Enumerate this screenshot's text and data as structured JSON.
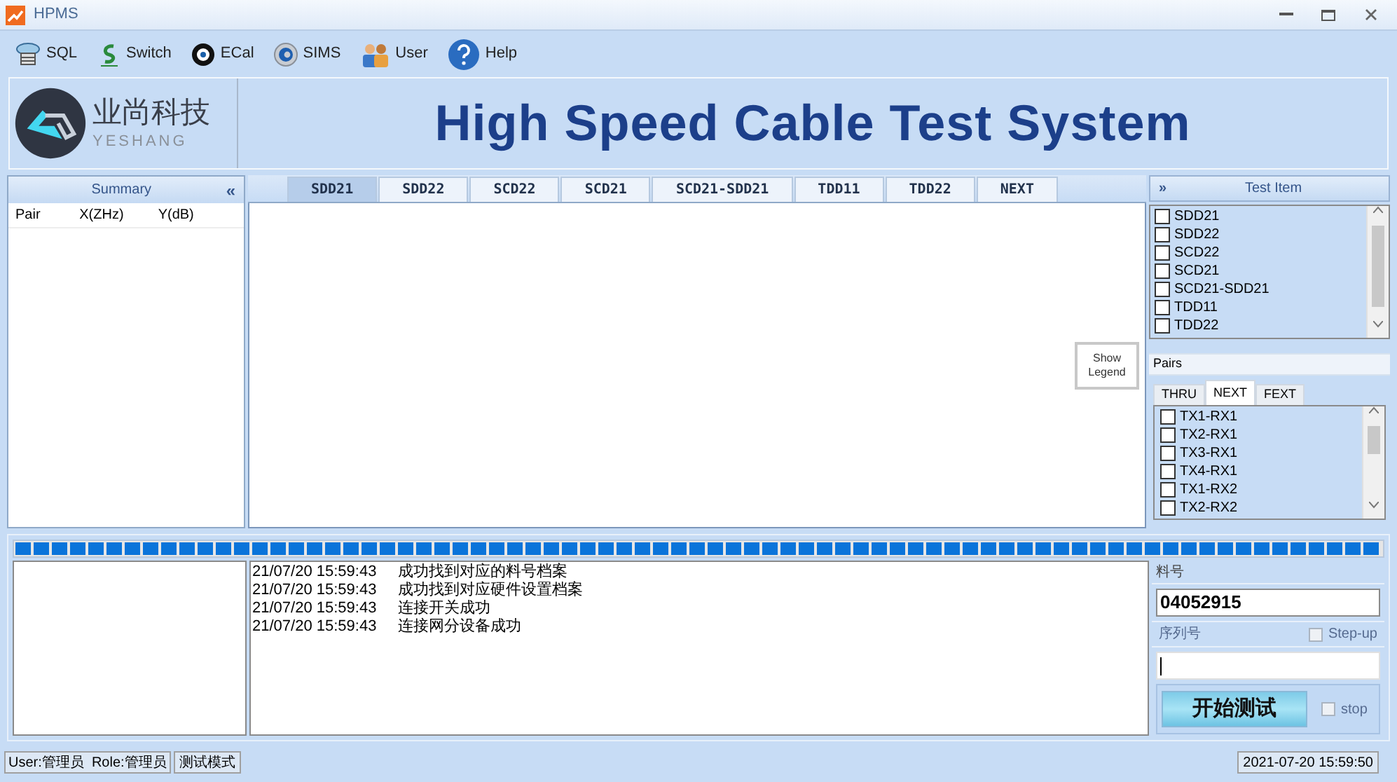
{
  "window": {
    "title": "HPMS"
  },
  "toolbar": [
    {
      "label": "SQL",
      "kind": "sql"
    },
    {
      "label": "Switch",
      "kind": "switch"
    },
    {
      "label": "ECal",
      "kind": "ecal"
    },
    {
      "label": "SIMS",
      "kind": "sims"
    },
    {
      "label": "User",
      "kind": "user"
    },
    {
      "label": "Help",
      "kind": "help"
    }
  ],
  "logo": {
    "name": "业尚科技",
    "latin": "YESHANG"
  },
  "banner_title": "High Speed Cable Test System",
  "summary": {
    "title": "Summary",
    "collapse": "«",
    "columns": [
      "Pair",
      "X(ZHz)",
      "Y(dB)"
    ]
  },
  "tabs": [
    {
      "label": "SDD21",
      "selected": true
    },
    {
      "label": "SDD22",
      "selected": false
    },
    {
      "label": "SCD22",
      "selected": false
    },
    {
      "label": "SCD21",
      "selected": false
    },
    {
      "label": "SCD21-SDD21",
      "selected": false
    },
    {
      "label": "TDD11",
      "selected": false
    },
    {
      "label": "TDD22",
      "selected": false
    },
    {
      "label": "NEXT",
      "selected": false
    }
  ],
  "legend_button": "Show Legend",
  "test_item": {
    "title": "Test Item",
    "expand": "»",
    "items": [
      {
        "label": "SDD21",
        "checked": false
      },
      {
        "label": "SDD22",
        "checked": false
      },
      {
        "label": "SCD22",
        "checked": false
      },
      {
        "label": "SCD21",
        "checked": false
      },
      {
        "label": "SCD21-SDD21",
        "checked": false
      },
      {
        "label": "TDD11",
        "checked": false
      },
      {
        "label": "TDD22",
        "checked": false
      }
    ]
  },
  "pairs": {
    "title": "Pairs",
    "tabs": [
      {
        "label": "THRU",
        "selected": false
      },
      {
        "label": "NEXT",
        "selected": true
      },
      {
        "label": "FEXT",
        "selected": false
      }
    ],
    "items": [
      {
        "label": "TX1-RX1",
        "checked": false
      },
      {
        "label": "TX2-RX1",
        "checked": false
      },
      {
        "label": "TX3-RX1",
        "checked": false
      },
      {
        "label": "TX4-RX1",
        "checked": false
      },
      {
        "label": "TX1-RX2",
        "checked": false
      },
      {
        "label": "TX2-RX2",
        "checked": false
      }
    ]
  },
  "progress": {
    "level": 1
  },
  "log": [
    {
      "time": "21/07/20 15:59:43",
      "message": "成功找到对应的料号档案"
    },
    {
      "time": "21/07/20 15:59:43",
      "message": "成功找到对应硬件设置档案"
    },
    {
      "time": "21/07/20 15:59:43",
      "message": "连接开关成功"
    },
    {
      "time": "21/07/20 15:59:43",
      "message": "连接网分设备成功"
    }
  ],
  "part_number": {
    "label": "料号",
    "value": "04052915"
  },
  "serial": {
    "label": "序列号",
    "step_up": {
      "label": "Step-up",
      "checked": false
    }
  },
  "start_button": "开始测试",
  "stop": {
    "label": "stop",
    "checked": false
  },
  "status_bar": {
    "user": "User:管理员  Role:管理员",
    "mode": "测试模式",
    "time": "2021-07-20 15:59:50"
  }
}
